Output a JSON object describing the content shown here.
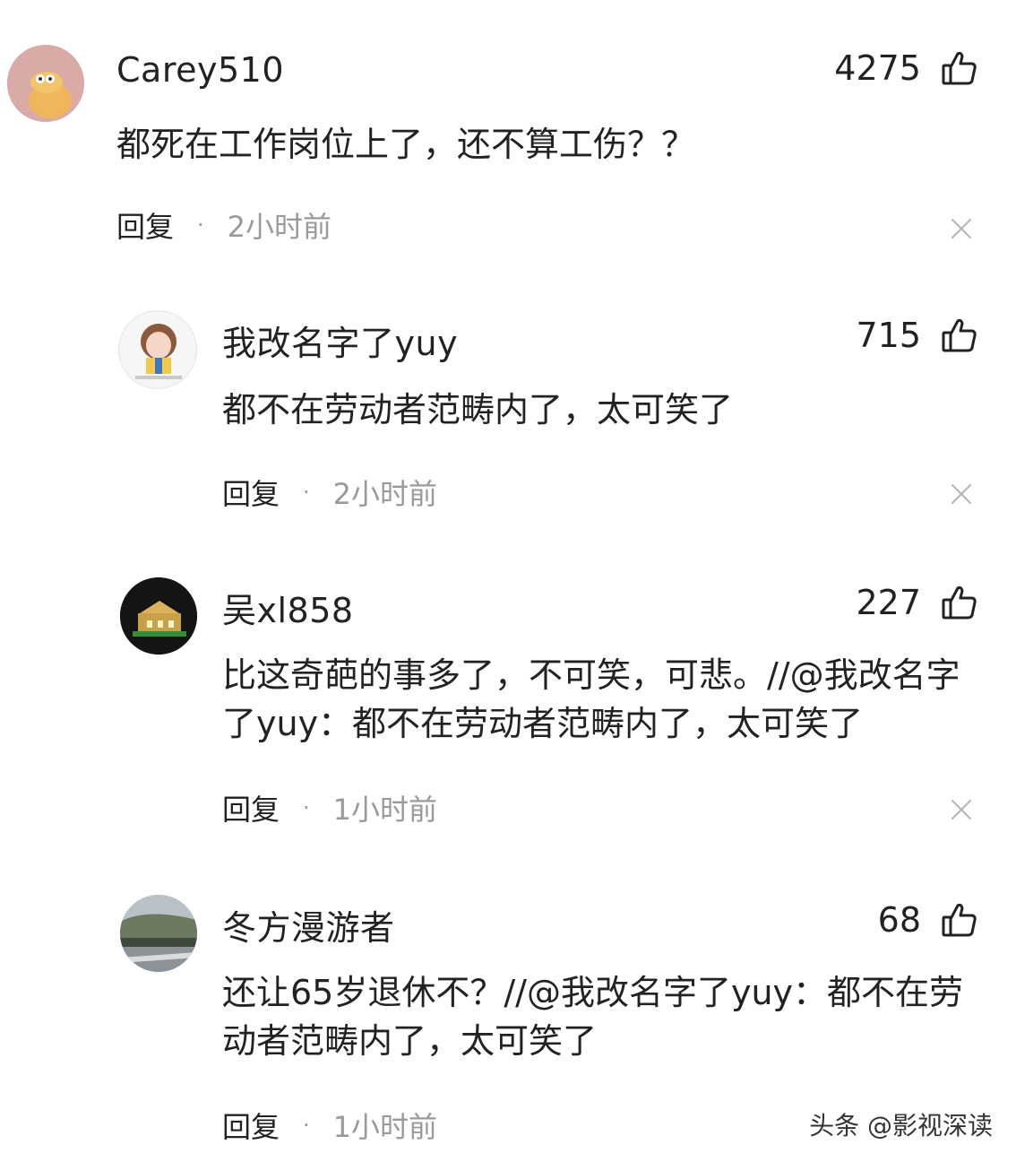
{
  "comments": [
    {
      "username": "Carey510",
      "likes": "4275",
      "text": "都死在工作岗位上了，还不算工伤？？",
      "reply_label": "回复",
      "separator": "·",
      "time": "2小时前"
    },
    {
      "username": "我改名字了yuy",
      "likes": "715",
      "text": "都不在劳动者范畴内了，太可笑了",
      "reply_label": "回复",
      "separator": "·",
      "time": "2小时前"
    },
    {
      "username": "吴xl858",
      "likes": "227",
      "text": "比这奇葩的事多了，不可笑，可悲。//@我改名字了yuy：都不在劳动者范畴内了，太可笑了",
      "reply_label": "回复",
      "separator": "·",
      "time": "1小时前"
    },
    {
      "username": "冬方漫游者",
      "likes": "68",
      "text": "还让65岁退休不？//@我改名字了yuy：都不在劳动者范畴内了，太可笑了",
      "reply_label": "回复",
      "separator": "·",
      "time": "1小时前"
    }
  ],
  "watermark": "头条 @影视深读",
  "icons": {
    "like": "thumbs-up-icon",
    "close": "close-icon"
  }
}
